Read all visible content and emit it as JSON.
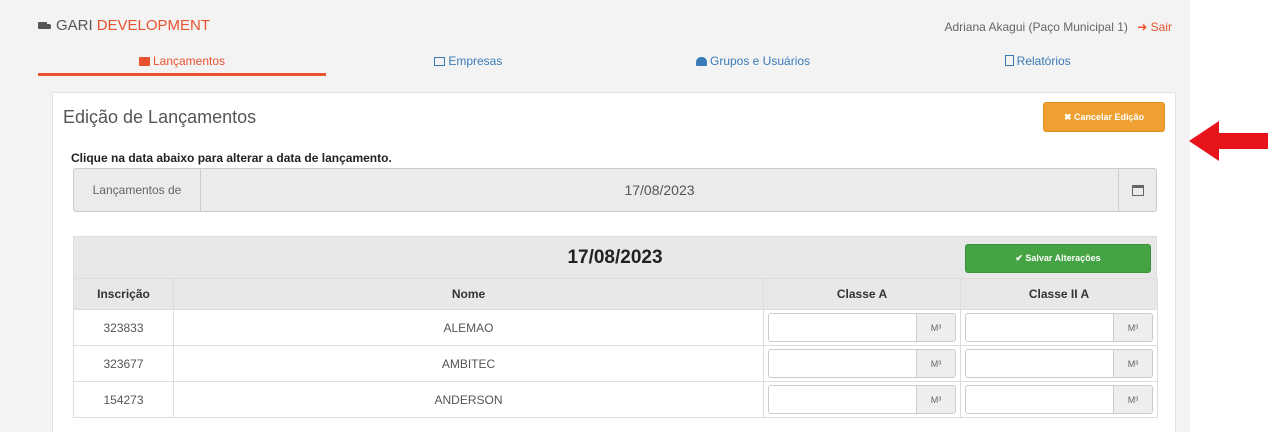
{
  "header": {
    "brand_prefix": "GARI",
    "brand_suffix": "DEVELOPMENT",
    "user": "Adriana Akagui (Paço Municipal 1)",
    "logout": "Sair"
  },
  "tabs": [
    {
      "label": "Lançamentos",
      "icon": "desktop-icon",
      "active": true
    },
    {
      "label": "Empresas",
      "icon": "building-icon",
      "active": false
    },
    {
      "label": "Grupos e Usuários",
      "icon": "users-icon",
      "active": false
    },
    {
      "label": "Relatórios",
      "icon": "file-icon",
      "active": false
    }
  ],
  "panel": {
    "title": "Edição de Lançamentos",
    "cancel_label": "✖ Cancelar Edição",
    "hint": "Clique na data abaixo para alterar a data de lançamento.",
    "date_label": "Lançamentos de",
    "date_value": "17/08/2023"
  },
  "grid": {
    "date": "17/08/2023",
    "save_label": "✔ Salvar Alterações",
    "columns": [
      "Inscrição",
      "Nome",
      "Classe A",
      "Classe II A"
    ],
    "unit": "M³",
    "rows": [
      {
        "inscricao": "323833",
        "nome": "ALEMAO"
      },
      {
        "inscricao": "323677",
        "nome": "AMBITEC"
      },
      {
        "inscricao": "154273",
        "nome": "ANDERSON"
      }
    ]
  },
  "colors": {
    "accent": "#e8522f",
    "link": "#3a7ab8",
    "warning_button": "#f0a030",
    "success_button": "#44a444",
    "arrow": "#e8141c"
  }
}
